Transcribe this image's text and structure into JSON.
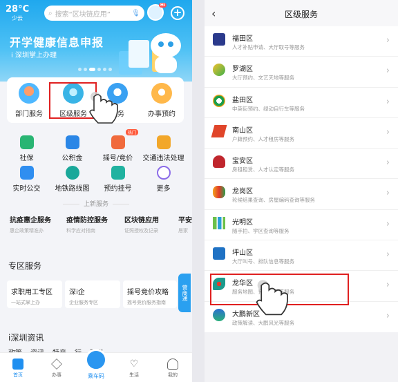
{
  "left": {
    "weather": {
      "temp": "28°C",
      "desc": "少云"
    },
    "search_placeholder": "搜索“区块链应用”",
    "robot_badge": "Hi",
    "banner": {
      "title": "开学健康信息申报",
      "subtitle": "i 深圳掌上办理"
    },
    "quick": [
      {
        "label": "部门服务"
      },
      {
        "label": "区级服务"
      },
      {
        "label": "服务"
      },
      {
        "label": "办事预约"
      }
    ],
    "grid": [
      {
        "label": "社保"
      },
      {
        "label": "公积金"
      },
      {
        "label": "摇号/竞价"
      },
      {
        "label": "交通违法处理"
      },
      {
        "label": "实时公交"
      },
      {
        "label": "地铁路线图"
      },
      {
        "label": "预约挂号"
      },
      {
        "label": "更多"
      }
    ],
    "hot_badge": "热门",
    "section_upper": "上新服务",
    "services": [
      {
        "title": "抗疫惠企服务",
        "desc": "惠企政策精准办"
      },
      {
        "title": "疫情防控服务",
        "desc": "科学应对指南"
      },
      {
        "title": "区块链应用",
        "desc": "证照授权及记录"
      },
      {
        "title": "平安",
        "desc": "居家"
      }
    ],
    "zone_title": "专区服务",
    "zone_cards": [
      {
        "title": "求职用工专区",
        "desc": "一站式掌上办"
      },
      {
        "title": "深i企",
        "desc": "企业服务专区"
      },
      {
        "title": "摇号竞价攻略",
        "desc": "摇号竞价服务指南"
      }
    ],
    "side_tab": "营商通",
    "news_title": "i深圳资讯",
    "news_tabs": [
      "政策",
      "资讯",
      "特产",
      "行",
      "服务"
    ],
    "tabbar": [
      {
        "label": "首页"
      },
      {
        "label": "办事"
      },
      {
        "label": "乘车码"
      },
      {
        "label": "生活"
      },
      {
        "label": "我的"
      }
    ]
  },
  "right": {
    "title": "区级服务",
    "districts": [
      {
        "name": "福田区",
        "desc": "人才补贴申请、大厅取号等服务",
        "color": "#2b3a8c"
      },
      {
        "name": "罗湖区",
        "desc": "大厅预约、文艺天地等服务",
        "color": "#3db04a"
      },
      {
        "name": "盐田区",
        "desc": "中英街预约、绿动自行车等服务",
        "color": "#1a9e4a"
      },
      {
        "name": "南山区",
        "desc": "户籍预约、人才租房等服务",
        "color": "#e0452a"
      },
      {
        "name": "宝安区",
        "desc": "房租租赁、人才认定等服务",
        "color": "#c0262d"
      },
      {
        "name": "龙岗区",
        "desc": "轮候结果查询、房屋编码查询等服务",
        "color": "#f2a31b"
      },
      {
        "name": "光明区",
        "desc": "随手拍、学区查询等服务",
        "color": "#6cc04a"
      },
      {
        "name": "坪山区",
        "desc": "大厅叫号、排队信息等服务",
        "color": "#1f72c4"
      },
      {
        "name": "龙华区",
        "desc": "服务地图、预约办理等服务",
        "color": "#1c9a8c"
      },
      {
        "name": "大鹏新区",
        "desc": "政策解读、大鹏风光等服务",
        "color": "#2a6fd1"
      }
    ]
  }
}
